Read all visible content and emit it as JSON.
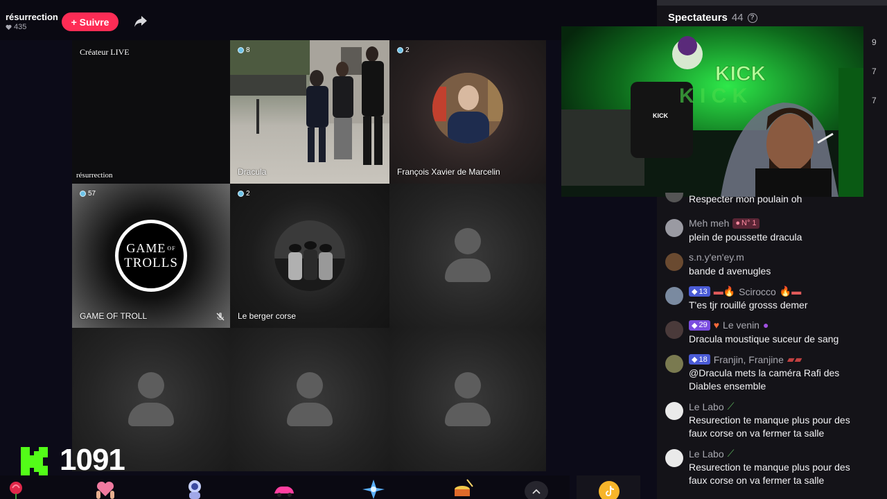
{
  "host": {
    "name": "résurrection",
    "likes": "435"
  },
  "follow_label": "+ Suivre",
  "tiles": [
    {
      "top_label": "Créateur LIVE",
      "label": "résurrection"
    },
    {
      "viewers": "8",
      "label": "Dracula"
    },
    {
      "viewers": "2",
      "label": "François Xavier de Marcelin"
    },
    {
      "viewers": "57",
      "label": "GAME OF TROLL",
      "logo_line1": "GAME",
      "logo_of": "OF",
      "logo_line2": "TROLLS"
    },
    {
      "viewers": "2",
      "label": "Le berger corse"
    }
  ],
  "kick_score": "1091",
  "spectators": {
    "title": "Spectateurs",
    "count": "44",
    "help": "?"
  },
  "side_numbers": [
    "9",
    "7",
    "7"
  ],
  "webcam": {
    "sign": "KICK",
    "shirt": "KICK"
  },
  "chat": [
    {
      "name": "",
      "text": "Respecter mon poulain oh"
    },
    {
      "name": "Meh meh",
      "badge": "N° 1",
      "text": "plein de poussette dracula"
    },
    {
      "name": "s.n.y'en'ey.m",
      "text": "bande d avenugles"
    },
    {
      "name": "Scirocco",
      "level": "13",
      "text": "T'es tjr rouillé grosss demer"
    },
    {
      "name": "Le venin",
      "level": "29",
      "text": "Dracula moustique suceur de sang"
    },
    {
      "name": "Franjin, Franjine",
      "level": "18",
      "text": "@Dracula mets la caméra Rafi des Diables ensemble"
    },
    {
      "name": "Le Labo",
      "text": "Resurection te manque plus pour des faux corse on va fermer ta salle"
    },
    {
      "name": "Le Labo",
      "text": "Resurection te manque plus pour des faux corse on va fermer ta salle"
    }
  ],
  "colors": {
    "accent": "#fe2c55",
    "kick_green": "#53fc18",
    "viewer_dot": "#6ec3e8"
  },
  "icons": [
    "heart-icon",
    "share-icon",
    "help-icon",
    "chevron-up-icon",
    "coin-icon",
    "rose-gift-icon"
  ]
}
